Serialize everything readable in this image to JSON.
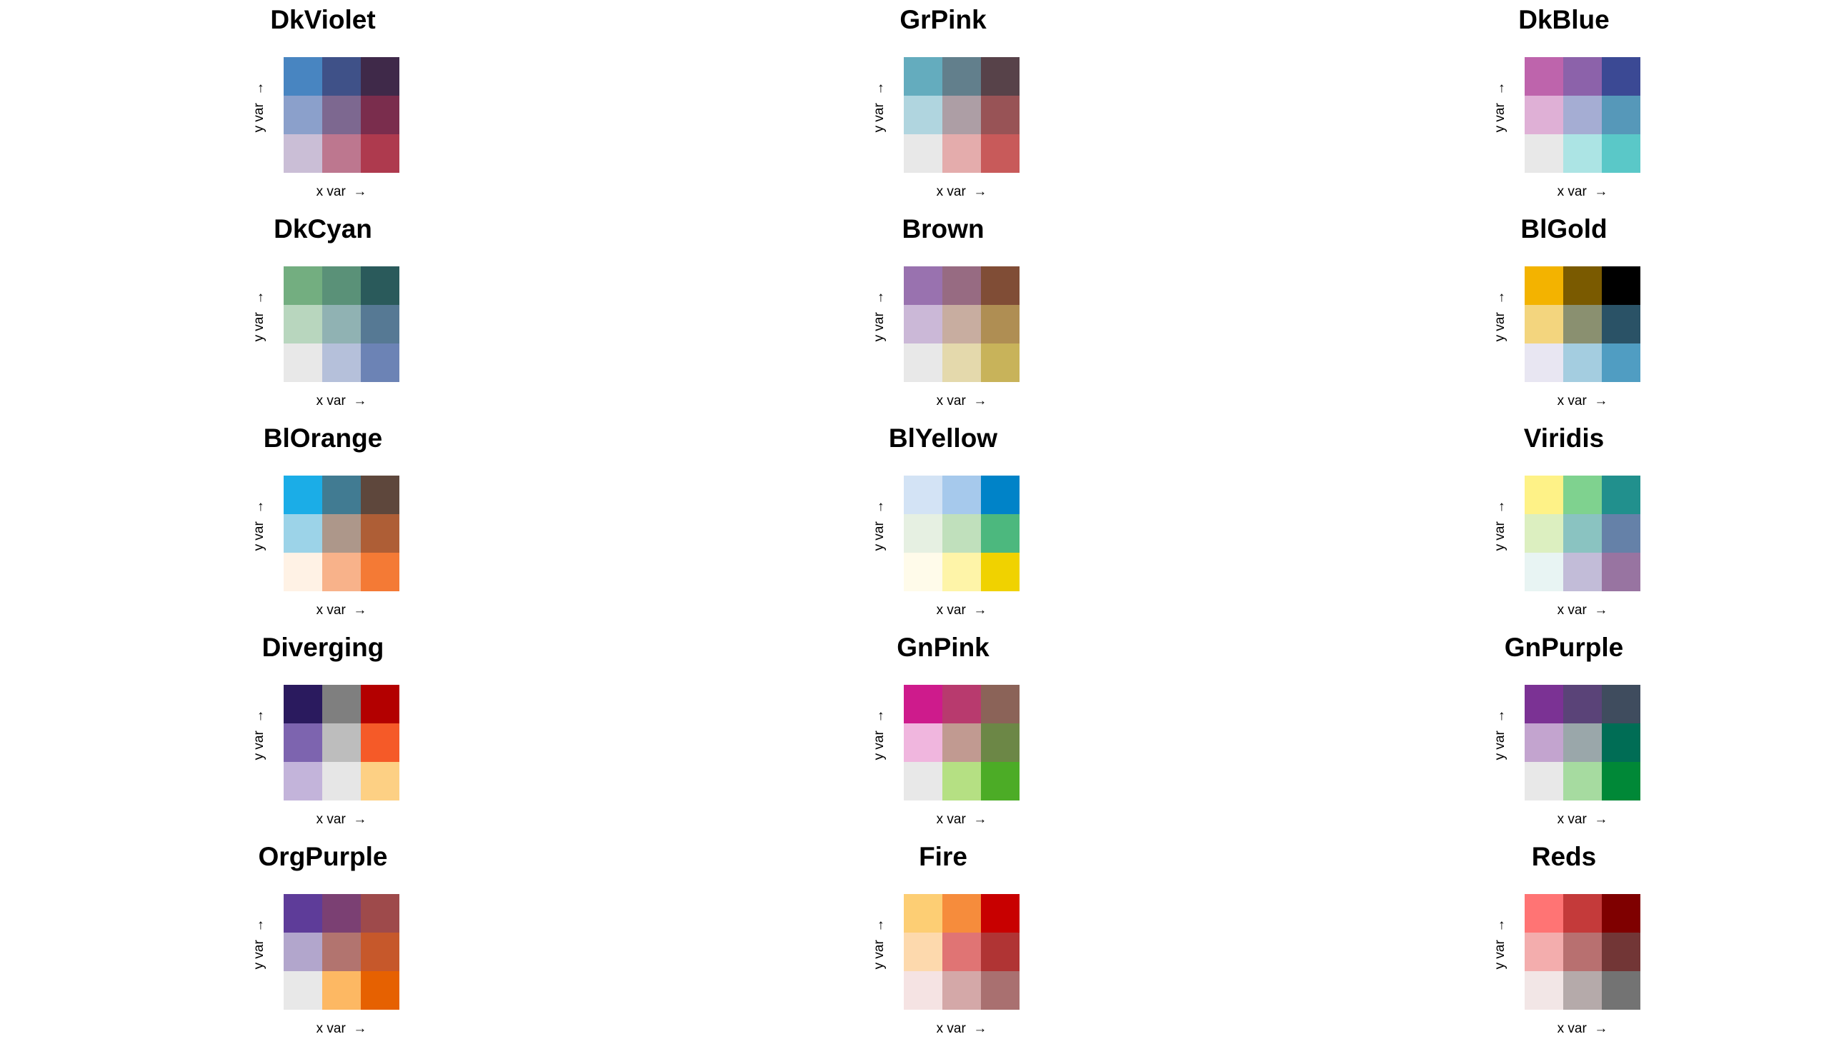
{
  "chart_data": [
    {
      "type": "heatmap",
      "title": "DkViolet",
      "xlabel": "x var",
      "ylabel": "y var",
      "x_arrow": "→",
      "y_arrow": "→",
      "rows": [
        [
          "#4885C1",
          "#3F5188",
          "#3F2949"
        ],
        [
          "#8BA0CB",
          "#7D6890",
          "#7A2D4D"
        ],
        [
          "#CABED6",
          "#BD778F",
          "#AE3A4E"
        ]
      ]
    },
    {
      "type": "heatmap",
      "title": "GrPink",
      "xlabel": "x var",
      "ylabel": "y var",
      "x_arrow": "→",
      "y_arrow": "→",
      "rows": [
        [
          "#64ACBE",
          "#627F8C",
          "#574249"
        ],
        [
          "#B0D5DF",
          "#AD9EA5",
          "#985356"
        ],
        [
          "#E8E8E8",
          "#E4ACAC",
          "#C85A5A"
        ]
      ]
    },
    {
      "type": "heatmap",
      "title": "DkBlue",
      "xlabel": "x var",
      "ylabel": "y var",
      "x_arrow": "→",
      "y_arrow": "→",
      "rows": [
        [
          "#BE64AC",
          "#8C62AA",
          "#3B4994"
        ],
        [
          "#DFB0D6",
          "#A5ADD3",
          "#5698B9"
        ],
        [
          "#E8E8E8",
          "#ACE4E4",
          "#5AC8C8"
        ]
      ]
    },
    {
      "type": "heatmap",
      "title": "DkCyan",
      "xlabel": "x var",
      "ylabel": "y var",
      "x_arrow": "→",
      "y_arrow": "→",
      "rows": [
        [
          "#73AE80",
          "#5A9178",
          "#2A5A5B"
        ],
        [
          "#B8D6BE",
          "#90B2B3",
          "#567994"
        ],
        [
          "#E8E8E8",
          "#B5C0DA",
          "#6C83B5"
        ]
      ]
    },
    {
      "type": "heatmap",
      "title": "Brown",
      "xlabel": "x var",
      "ylabel": "y var",
      "x_arrow": "→",
      "y_arrow": "→",
      "rows": [
        [
          "#9972AF",
          "#976B82",
          "#804D36"
        ],
        [
          "#CBB8D7",
          "#C8ADA0",
          "#AF8E53"
        ],
        [
          "#E8E8E8",
          "#E4D9AC",
          "#C8B35A"
        ]
      ]
    },
    {
      "type": "heatmap",
      "title": "BlGold",
      "xlabel": "x var",
      "ylabel": "y var",
      "x_arrow": "→",
      "y_arrow": "→",
      "rows": [
        [
          "#F3B300",
          "#7A5A00",
          "#000000"
        ],
        [
          "#F3D57E",
          "#8A9070",
          "#2A5266"
        ],
        [
          "#E8E6F2",
          "#A4CDE0",
          "#509DC2"
        ]
      ]
    },
    {
      "type": "heatmap",
      "title": "BlOrange",
      "xlabel": "x var",
      "ylabel": "y var",
      "x_arrow": "→",
      "y_arrow": "→",
      "rows": [
        [
          "#1BADE7",
          "#417B92",
          "#5E473C"
        ],
        [
          "#9CD3E8",
          "#AD978A",
          "#AE5E36"
        ],
        [
          "#FFF2E5",
          "#F8B28A",
          "#F47A35"
        ]
      ]
    },
    {
      "type": "heatmap",
      "title": "BlYellow",
      "xlabel": "x var",
      "ylabel": "y var",
      "x_arrow": "→",
      "y_arrow": "→",
      "rows": [
        [
          "#D3E3F5",
          "#A6C9EC",
          "#0083C8"
        ],
        [
          "#E6F0E2",
          "#C0E0BC",
          "#4CB87E"
        ],
        [
          "#FFFBEA",
          "#FEF4A8",
          "#F0D200"
        ]
      ]
    },
    {
      "type": "heatmap",
      "title": "Viridis",
      "xlabel": "x var",
      "ylabel": "y var",
      "x_arrow": "→",
      "y_arrow": "→",
      "rows": [
        [
          "#FEF287",
          "#7FD28F",
          "#21908D"
        ],
        [
          "#DCEFC0",
          "#8AC3C1",
          "#6581A8"
        ],
        [
          "#E8F4F3",
          "#C2BCD8",
          "#9874A1"
        ]
      ]
    },
    {
      "type": "heatmap",
      "title": "Diverging",
      "xlabel": "x var",
      "ylabel": "y var",
      "x_arrow": "→",
      "y_arrow": "→",
      "rows": [
        [
          "#2A1A5E",
          "#7F7F7F",
          "#B30000"
        ],
        [
          "#7D64AF",
          "#BDBDBD",
          "#F55A28"
        ],
        [
          "#C3B4DA",
          "#E6E6E6",
          "#FDD084"
        ]
      ]
    },
    {
      "type": "heatmap",
      "title": "GnPink",
      "xlabel": "x var",
      "ylabel": "y var",
      "x_arrow": "→",
      "y_arrow": "→",
      "rows": [
        [
          "#CE1B8C",
          "#B83A6E",
          "#8B6358"
        ],
        [
          "#F0B6DE",
          "#C19A91",
          "#6C8746"
        ],
        [
          "#E8E8E8",
          "#B5E083",
          "#4CAC26"
        ]
      ]
    },
    {
      "type": "heatmap",
      "title": "GnPurple",
      "xlabel": "x var",
      "ylabel": "y var",
      "x_arrow": "→",
      "y_arrow": "→",
      "rows": [
        [
          "#7B3294",
          "#5A4378",
          "#3F4C5E"
        ],
        [
          "#C3A4CF",
          "#9AA7AA",
          "#006D55"
        ],
        [
          "#E8E8E8",
          "#A6DBA0",
          "#008837"
        ]
      ]
    },
    {
      "type": "heatmap",
      "title": "OrgPurple",
      "xlabel": "x var",
      "ylabel": "y var",
      "x_arrow": "→",
      "y_arrow": "→",
      "rows": [
        [
          "#5E3C99",
          "#7B4073",
          "#9E4A4B"
        ],
        [
          "#B2A6CC",
          "#B2746F",
          "#C6582B"
        ],
        [
          "#E8E8E8",
          "#FDB863",
          "#E66101"
        ]
      ]
    },
    {
      "type": "heatmap",
      "title": "Fire",
      "xlabel": "x var",
      "ylabel": "y var",
      "x_arrow": "→",
      "y_arrow": "→",
      "rows": [
        [
          "#FDCE74",
          "#F68C3C",
          "#C80000"
        ],
        [
          "#FDD9AD",
          "#E07474",
          "#B03434"
        ],
        [
          "#F5E3E3",
          "#D4A8A8",
          "#A97070"
        ]
      ]
    },
    {
      "type": "heatmap",
      "title": "Reds",
      "xlabel": "x var",
      "ylabel": "y var",
      "x_arrow": "→",
      "y_arrow": "→",
      "rows": [
        [
          "#FF7474",
          "#C43A3A",
          "#7F0000"
        ],
        [
          "#F3ADAD",
          "#B87070",
          "#723636"
        ],
        [
          "#F2E6E6",
          "#B5AAAA",
          "#737373"
        ]
      ]
    }
  ]
}
